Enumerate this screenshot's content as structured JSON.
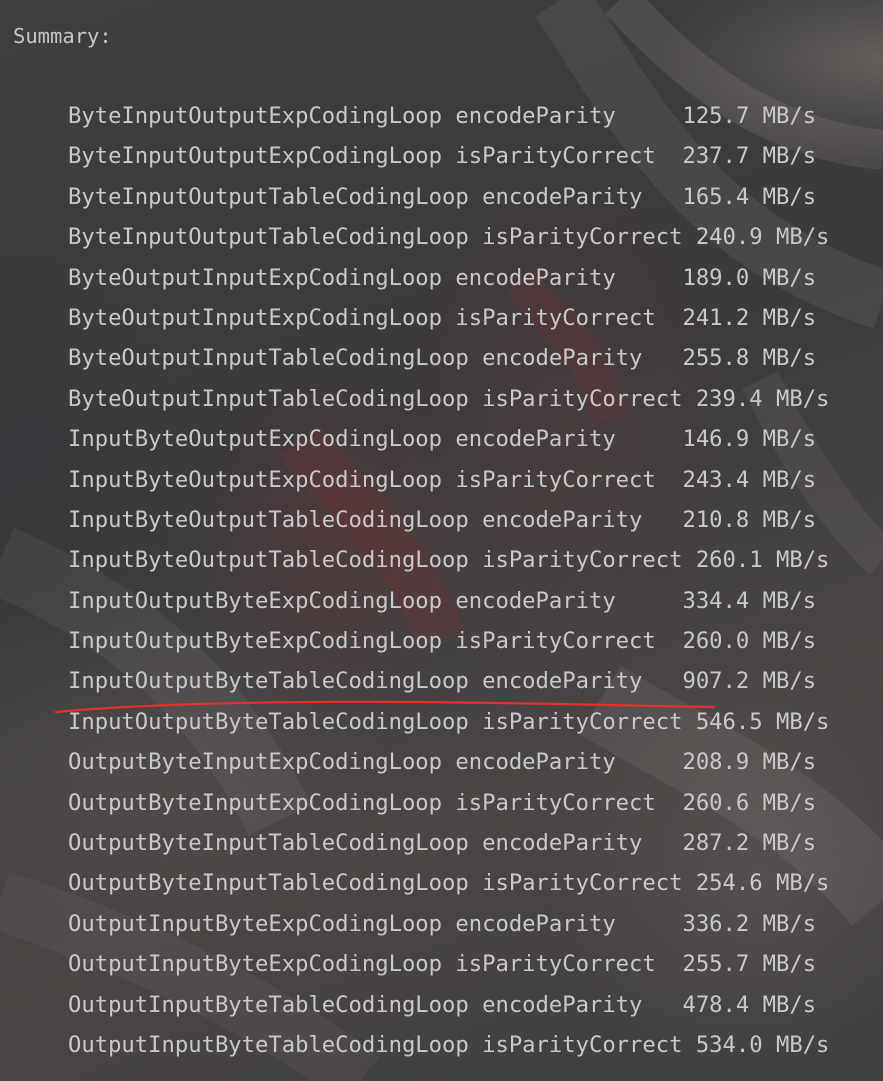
{
  "summary_label": "Summary:",
  "results": [
    {
      "name": "ByteInputOutputExpCodingLoop encodeParity     ",
      "rate": "125.7 MB/s"
    },
    {
      "name": "ByteInputOutputExpCodingLoop isParityCorrect  ",
      "rate": "237.7 MB/s"
    },
    {
      "name": "ByteInputOutputTableCodingLoop encodeParity   ",
      "rate": "165.4 MB/s"
    },
    {
      "name": "ByteInputOutputTableCodingLoop isParityCorrect ",
      "rate": "240.9 MB/s"
    },
    {
      "name": "ByteOutputInputExpCodingLoop encodeParity     ",
      "rate": "189.0 MB/s"
    },
    {
      "name": "ByteOutputInputExpCodingLoop isParityCorrect  ",
      "rate": "241.2 MB/s"
    },
    {
      "name": "ByteOutputInputTableCodingLoop encodeParity   ",
      "rate": "255.8 MB/s"
    },
    {
      "name": "ByteOutputInputTableCodingLoop isParityCorrect ",
      "rate": "239.4 MB/s"
    },
    {
      "name": "InputByteOutputExpCodingLoop encodeParity     ",
      "rate": "146.9 MB/s"
    },
    {
      "name": "InputByteOutputExpCodingLoop isParityCorrect  ",
      "rate": "243.4 MB/s"
    },
    {
      "name": "InputByteOutputTableCodingLoop encodeParity   ",
      "rate": "210.8 MB/s"
    },
    {
      "name": "InputByteOutputTableCodingLoop isParityCorrect ",
      "rate": "260.1 MB/s"
    },
    {
      "name": "InputOutputByteExpCodingLoop encodeParity     ",
      "rate": "334.4 MB/s"
    },
    {
      "name": "InputOutputByteExpCodingLoop isParityCorrect  ",
      "rate": "260.0 MB/s"
    },
    {
      "name": "InputOutputByteTableCodingLoop encodeParity   ",
      "rate": "907.2 MB/s"
    },
    {
      "name": "InputOutputByteTableCodingLoop isParityCorrect ",
      "rate": "546.5 MB/s"
    },
    {
      "name": "OutputByteInputExpCodingLoop encodeParity     ",
      "rate": "208.9 MB/s"
    },
    {
      "name": "OutputByteInputExpCodingLoop isParityCorrect  ",
      "rate": "260.6 MB/s"
    },
    {
      "name": "OutputByteInputTableCodingLoop encodeParity   ",
      "rate": "287.2 MB/s"
    },
    {
      "name": "OutputByteInputTableCodingLoop isParityCorrect ",
      "rate": "254.6 MB/s"
    },
    {
      "name": "OutputInputByteExpCodingLoop encodeParity     ",
      "rate": "336.2 MB/s"
    },
    {
      "name": "OutputInputByteExpCodingLoop isParityCorrect  ",
      "rate": "255.7 MB/s"
    },
    {
      "name": "OutputInputByteTableCodingLoop encodeParity   ",
      "rate": "478.4 MB/s"
    },
    {
      "name": "OutputInputByteTableCodingLoop isParityCorrect ",
      "rate": "534.0 MB/s"
    }
  ],
  "colors": {
    "background": "#3a3a3c",
    "text": "#c9c9c9",
    "highlight_underline": "#e8302d"
  }
}
